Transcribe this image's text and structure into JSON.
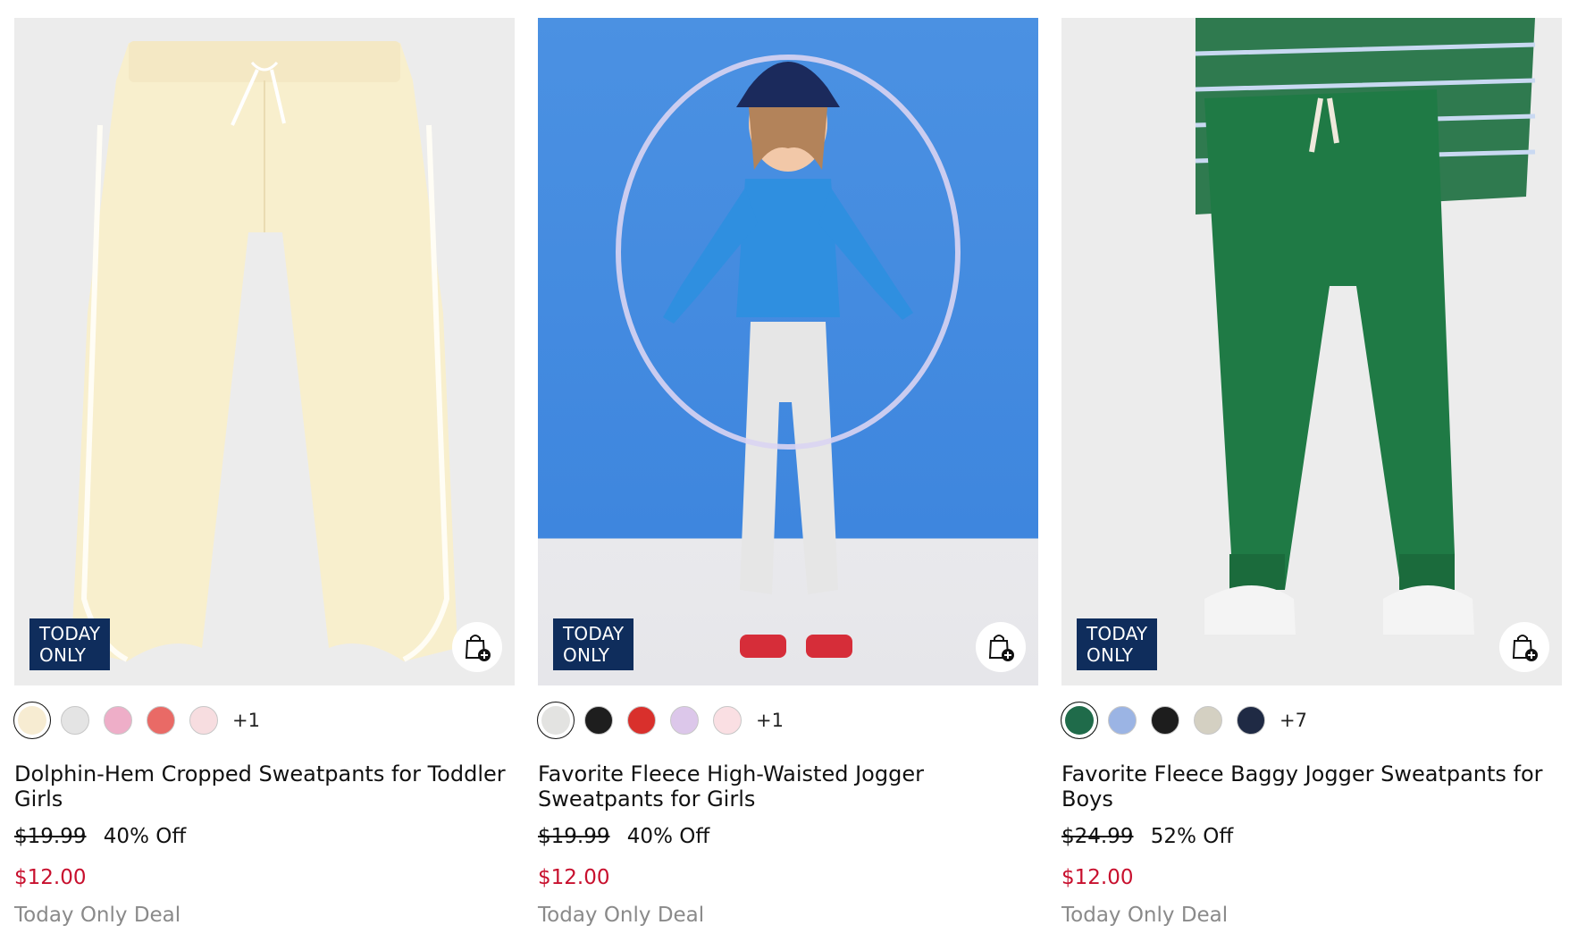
{
  "products": [
    {
      "badge": [
        "TODAY",
        "ONLY"
      ],
      "swatches": [
        "#f7ecd2",
        "#e4e4e4",
        "#eeaec8",
        "#e96a66",
        "#f7dde0"
      ],
      "more_colors": "+1",
      "title": "Dolphin-Hem Cropped Sweatpants for Toddler Girls",
      "original_price": "$19.99",
      "discount": "40% Off",
      "sale_price": "$12.00",
      "deal": "Today Only Deal"
    },
    {
      "badge": [
        "TODAY",
        "ONLY"
      ],
      "swatches": [
        "#e3e3e1",
        "#1e1e1e",
        "#d9302c",
        "#dcc7ea",
        "#fadfe3"
      ],
      "more_colors": "+1",
      "title": "Favorite Fleece High-Waisted Jogger Sweatpants for Girls",
      "original_price": "$19.99",
      "discount": "40% Off",
      "sale_price": "$12.00",
      "deal": "Today Only Deal"
    },
    {
      "badge": [
        "TODAY",
        "ONLY"
      ],
      "swatches": [
        "#1f6b4a",
        "#9bb4e4",
        "#1d1d1d",
        "#d4d0c2",
        "#1f2a44"
      ],
      "more_colors": "+7",
      "title": "Favorite Fleece Baggy Jogger Sweatpants for Boys",
      "original_price": "$24.99",
      "discount": "52% Off",
      "sale_price": "$12.00",
      "deal": "Today Only Deal"
    }
  ],
  "colors": {
    "badge_bg": "#0f2d5c",
    "sale_red": "#c8102e",
    "muted_gray": "#8a8a8a"
  },
  "icons": {
    "bag": "shopping-bag-add-icon"
  }
}
